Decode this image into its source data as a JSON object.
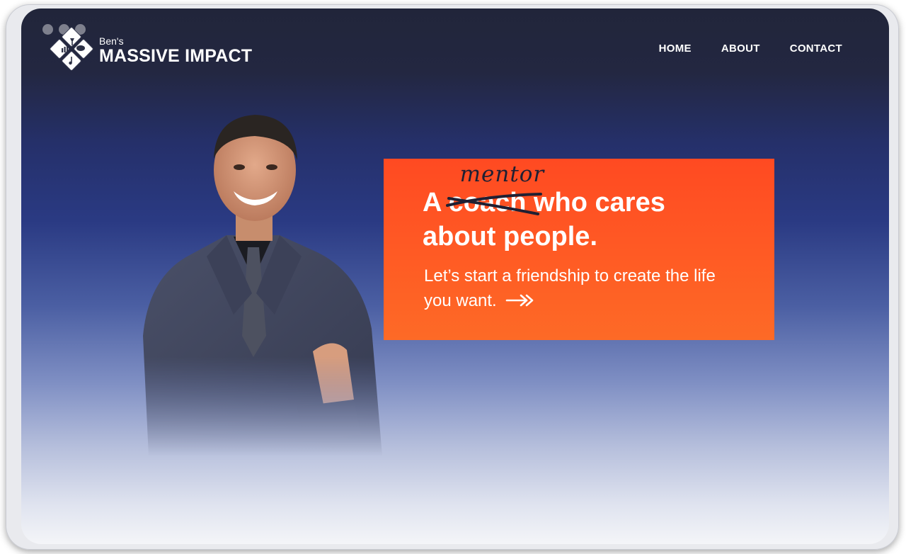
{
  "site": {
    "logo_small": "Ben's",
    "logo_big": "MASSIVE IMPACT"
  },
  "nav": {
    "items": [
      {
        "label": "HOME"
      },
      {
        "label": "ABOUT"
      },
      {
        "label": "CONTACT"
      }
    ]
  },
  "hero": {
    "headline_prefix": "A",
    "struck_word": "coach",
    "handwritten_word": "mentor",
    "headline_rest_line1": "who cares",
    "headline_line2": "about people.",
    "subline": "Let’s start a friendship to create the life you want."
  },
  "colors": {
    "accent": "#ff5722",
    "header_bg": "#21253a",
    "text_light": "#ffffff",
    "handwriting": "#1f2033"
  },
  "icons": {
    "logo": "diamond-grid-logo-icon",
    "arrow": "double-arrow-right-icon"
  }
}
